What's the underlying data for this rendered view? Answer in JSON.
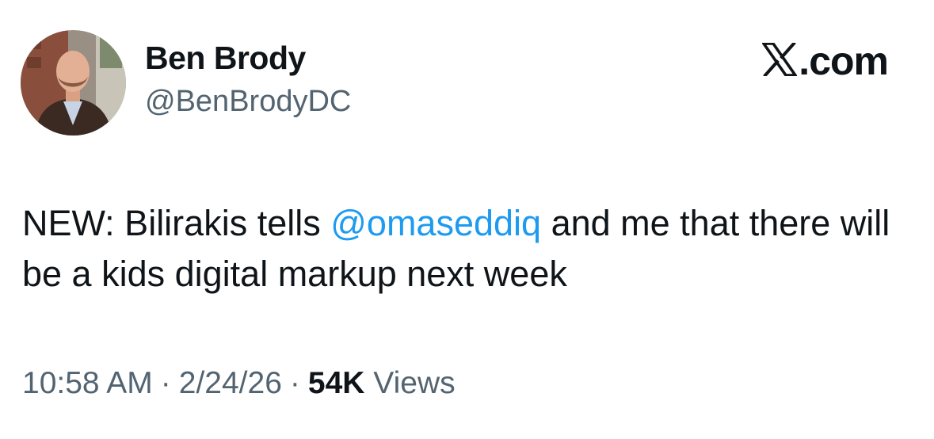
{
  "author": {
    "display_name": "Ben Brody",
    "handle": "@BenBrodyDC"
  },
  "brand": {
    "icon": "x-logo-icon",
    "text": ".com"
  },
  "tweet": {
    "text_before": "NEW: Bilirakis tells ",
    "mention": "@omaseddiq",
    "text_after": " and me that there will be a kids digital markup next week"
  },
  "meta": {
    "time": "10:58 AM",
    "separator": "·",
    "date": "2/24/26",
    "views_count": "54K",
    "views_label": "Views"
  },
  "colors": {
    "mention": "#1d9bf0",
    "secondary_text": "#536471",
    "primary_text": "#0f1419",
    "background": "#ffffff"
  }
}
